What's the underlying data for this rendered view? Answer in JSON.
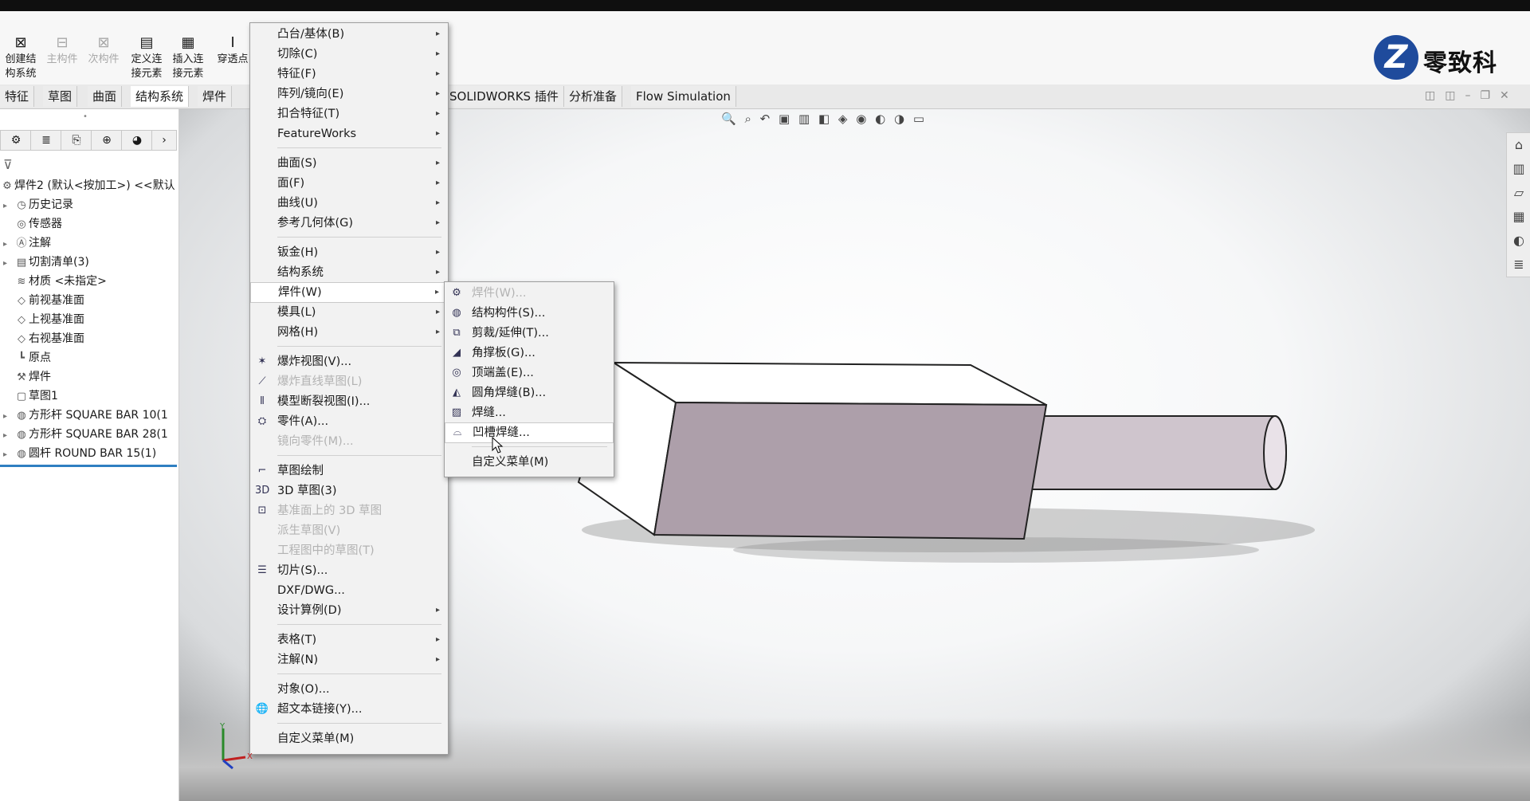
{
  "ribbon": {
    "buttons": [
      {
        "label1": "创建结",
        "label2": "构系统",
        "icon": "weldment-structure-icon",
        "enabled": true
      },
      {
        "label1": "主构件",
        "label2": "",
        "icon": "primary-member-icon",
        "enabled": false
      },
      {
        "label1": "次构件",
        "label2": "",
        "icon": "secondary-member-icon",
        "enabled": false
      },
      {
        "label1": "定义连",
        "label2": "接元素",
        "icon": "define-connection-icon",
        "enabled": true
      },
      {
        "label1": "插入连",
        "label2": "接元素",
        "icon": "insert-connection-icon",
        "enabled": true
      },
      {
        "label1": "穿透点",
        "label2": "",
        "icon": "pierce-point-icon",
        "enabled": true
      }
    ]
  },
  "logo": {
    "symbol": "Z",
    "text": "零致科技"
  },
  "tabs": [
    "特征",
    "草图",
    "曲面",
    "结构系统",
    "焊件",
    "SOLIDWORKS 插件",
    "分析准备",
    "Flow Simulation"
  ],
  "active_tab": "结构系统",
  "tree": {
    "root": "焊件2 (默认<按加工>) <<默认",
    "items": [
      {
        "label": "历史记录",
        "expandable": true
      },
      {
        "label": "传感器",
        "expandable": false
      },
      {
        "label": "注解",
        "expandable": true
      },
      {
        "label": "切割清单(3)",
        "expandable": true
      },
      {
        "label": "材质 <未指定>",
        "expandable": false
      },
      {
        "label": "前视基准面",
        "expandable": false
      },
      {
        "label": "上视基准面",
        "expandable": false
      },
      {
        "label": "右视基准面",
        "expandable": false
      },
      {
        "label": "原点",
        "expandable": false
      },
      {
        "label": "焊件",
        "expandable": false
      },
      {
        "label": "草图1",
        "expandable": false
      },
      {
        "label": "方形杆 SQUARE BAR 10(1",
        "expandable": true
      },
      {
        "label": "方形杆 SQUARE BAR 28(1",
        "expandable": true
      },
      {
        "label": "圆杆 ROUND BAR 15(1)",
        "expandable": true
      }
    ]
  },
  "insert_menu": {
    "items": [
      {
        "label": "凸台/基体(B)",
        "submenu": true,
        "enabled": true
      },
      {
        "label": "切除(C)",
        "submenu": true,
        "enabled": true
      },
      {
        "label": "特征(F)",
        "submenu": true,
        "enabled": true
      },
      {
        "label": "阵列/镜向(E)",
        "submenu": true,
        "enabled": true
      },
      {
        "label": "扣合特征(T)",
        "submenu": true,
        "enabled": true
      },
      {
        "label": "FeatureWorks",
        "submenu": true,
        "enabled": true
      },
      {
        "label": "曲面(S)",
        "submenu": true,
        "enabled": true
      },
      {
        "label": "面(F)",
        "submenu": true,
        "enabled": true
      },
      {
        "label": "曲线(U)",
        "submenu": true,
        "enabled": true
      },
      {
        "label": "参考几何体(G)",
        "submenu": true,
        "enabled": true
      },
      {
        "label": "钣金(H)",
        "submenu": true,
        "enabled": true
      },
      {
        "label": "结构系统",
        "submenu": true,
        "enabled": true
      },
      {
        "label": "焊件(W)",
        "submenu": true,
        "enabled": true
      },
      {
        "label": "模具(L)",
        "submenu": true,
        "enabled": true
      },
      {
        "label": "网格(H)",
        "submenu": true,
        "enabled": true
      },
      {
        "label": "爆炸视图(V)...",
        "submenu": false,
        "enabled": true
      },
      {
        "label": "爆炸直线草图(L)",
        "submenu": false,
        "enabled": false
      },
      {
        "label": "模型断裂视图(I)...",
        "submenu": false,
        "enabled": true
      },
      {
        "label": "零件(A)...",
        "submenu": false,
        "enabled": true
      },
      {
        "label": "镜向零件(M)...",
        "submenu": false,
        "enabled": false
      },
      {
        "label": "草图绘制",
        "submenu": false,
        "enabled": true
      },
      {
        "label": "3D 草图(3)",
        "submenu": false,
        "enabled": true
      },
      {
        "label": "基准面上的 3D 草图",
        "submenu": false,
        "enabled": false
      },
      {
        "label": "派生草图(V)",
        "submenu": false,
        "enabled": false
      },
      {
        "label": "工程图中的草图(T)",
        "submenu": false,
        "enabled": false
      },
      {
        "label": "切片(S)...",
        "submenu": false,
        "enabled": true
      },
      {
        "label": "DXF/DWG...",
        "submenu": false,
        "enabled": true
      },
      {
        "label": "设计算例(D)",
        "submenu": true,
        "enabled": true
      },
      {
        "label": "表格(T)",
        "submenu": true,
        "enabled": true
      },
      {
        "label": "注解(N)",
        "submenu": true,
        "enabled": true
      },
      {
        "label": "对象(O)...",
        "submenu": false,
        "enabled": true
      },
      {
        "label": "超文本链接(Y)...",
        "submenu": false,
        "enabled": true
      },
      {
        "label": "自定义菜单(M)",
        "submenu": false,
        "enabled": true
      }
    ]
  },
  "weldment_submenu": {
    "items": [
      {
        "label": "焊件(W)...",
        "enabled": false
      },
      {
        "label": "结构构件(S)...",
        "enabled": true
      },
      {
        "label": "剪裁/延伸(T)...",
        "enabled": true
      },
      {
        "label": "角撑板(G)...",
        "enabled": true
      },
      {
        "label": "顶端盖(E)...",
        "enabled": true
      },
      {
        "label": "圆角焊缝(B)...",
        "enabled": true
      },
      {
        "label": "焊缝...",
        "enabled": true
      },
      {
        "label": "凹槽焊缝...",
        "enabled": true
      },
      {
        "label": "自定义菜单(M)",
        "enabled": true
      }
    ],
    "hovered": "凹槽焊缝..."
  },
  "colors": {
    "part_face_front": "#ad9faa",
    "part_face_top": "#ffffff",
    "brand_blue": "#1f4b9c"
  }
}
